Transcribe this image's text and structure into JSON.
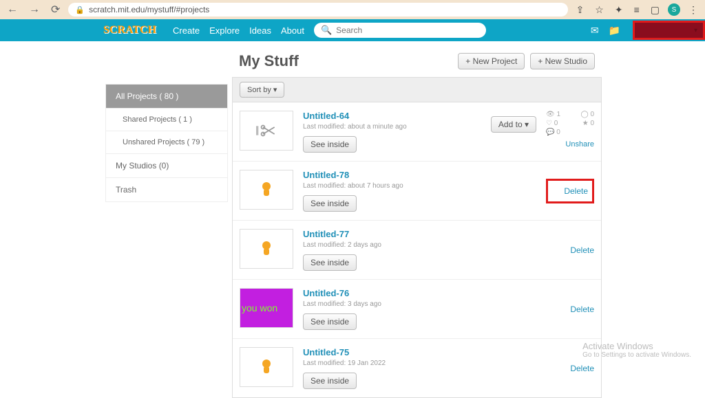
{
  "browser": {
    "url": "scratch.mit.edu/mystuff/#projects",
    "avatar_letter": "S"
  },
  "nav": {
    "links": [
      "Create",
      "Explore",
      "Ideas",
      "About"
    ],
    "search_placeholder": "Search"
  },
  "page": {
    "title": "My Stuff",
    "new_project": "+ New Project",
    "new_studio": "+ New Studio",
    "sort_label": "Sort by"
  },
  "sidebar": {
    "items": [
      {
        "label": "All Projects ( 80 )",
        "active": true
      },
      {
        "label": "Shared Projects ( 1 )",
        "sub": true
      },
      {
        "label": "Unshared Projects ( 79 )",
        "sub": true
      },
      {
        "label": "My Studios (0)"
      },
      {
        "label": "Trash"
      }
    ]
  },
  "projects": [
    {
      "title": "Untitled-64",
      "modified": "Last modified: about a minute ago",
      "see_inside": "See inside",
      "add_to": "Add to",
      "shared": true,
      "stats": {
        "views": "1",
        "loves": "0",
        "favs": "0",
        "remixes": "0",
        "comments": "0"
      },
      "unshare": "Unshare",
      "thumb": "scissor"
    },
    {
      "title": "Untitled-78",
      "modified": "Last modified: about 7 hours ago",
      "see_inside": "See inside",
      "delete": "Delete",
      "thumb": "cat",
      "delete_boxed": true
    },
    {
      "title": "Untitled-77",
      "modified": "Last modified: 2 days ago",
      "see_inside": "See inside",
      "delete": "Delete",
      "thumb": "cat"
    },
    {
      "title": "Untitled-76",
      "modified": "Last modified: 3 days ago",
      "see_inside": "See inside",
      "delete": "Delete",
      "thumb": "youwon",
      "thumb_text": "you won"
    },
    {
      "title": "Untitled-75",
      "modified": "Last modified: 19 Jan 2022",
      "see_inside": "See inside",
      "delete": "Delete",
      "thumb": "cat"
    }
  ],
  "watermark": {
    "title": "Activate Windows",
    "sub": "Go to Settings to activate Windows."
  }
}
